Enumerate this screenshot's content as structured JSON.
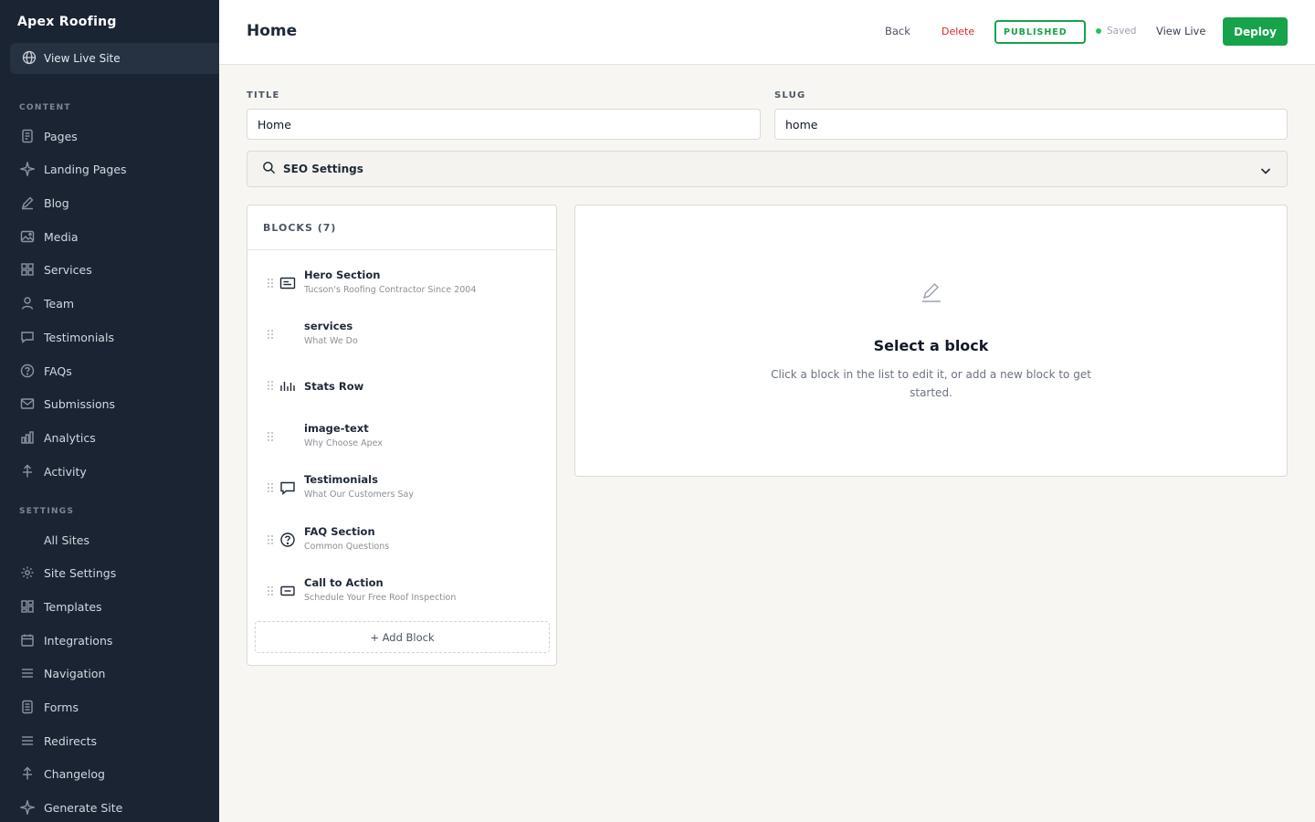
{
  "sidebar": {
    "brand": "Apex Roofing",
    "view_live_site": "View Live Site",
    "content_label": "CONTENT",
    "settings_label": "SETTINGS",
    "content_items": [
      {
        "label": "Pages",
        "icon": "page-icon"
      },
      {
        "label": "Landing Pages",
        "icon": "sparkle-icon"
      },
      {
        "label": "Blog",
        "icon": "pen-icon"
      },
      {
        "label": "Media",
        "icon": "image-icon"
      },
      {
        "label": "Services",
        "icon": "grid-icon"
      },
      {
        "label": "Team",
        "icon": "user-icon"
      },
      {
        "label": "Testimonials",
        "icon": "chat-icon"
      },
      {
        "label": "FAQs",
        "icon": "question-icon"
      },
      {
        "label": "Submissions",
        "icon": "mail-icon"
      },
      {
        "label": "Analytics",
        "icon": "bar-chart-icon"
      },
      {
        "label": "Activity",
        "icon": "activity-icon"
      }
    ],
    "settings_items": [
      {
        "label": "All Sites",
        "icon": ""
      },
      {
        "label": "Site Settings",
        "icon": "gear-icon"
      },
      {
        "label": "Templates",
        "icon": "template-icon"
      },
      {
        "label": "Integrations",
        "icon": "calendar-icon"
      },
      {
        "label": "Navigation",
        "icon": "menu-icon"
      },
      {
        "label": "Forms",
        "icon": "form-icon"
      },
      {
        "label": "Redirects",
        "icon": "redirect-icon"
      },
      {
        "label": "Changelog",
        "icon": "changelog-icon"
      },
      {
        "label": "Generate Site",
        "icon": "sparkle-icon"
      }
    ]
  },
  "header": {
    "title": "Home",
    "back": "Back",
    "delete": "Delete",
    "status": "PUBLISHED",
    "saved": "Saved",
    "view_live": "View Live",
    "deploy": "Deploy"
  },
  "form": {
    "title_label": "TITLE",
    "title_value": "Home",
    "slug_label": "SLUG",
    "slug_value": "home",
    "seo_label": "SEO Settings"
  },
  "blocks": {
    "heading": "BLOCKS (7)",
    "items": [
      {
        "name": "Hero Section",
        "subtitle": "Tucson's Roofing Contractor Since 2004",
        "icon": "hero-icon"
      },
      {
        "name": "services",
        "subtitle": "What We Do",
        "icon": ""
      },
      {
        "name": "Stats Row",
        "subtitle": "",
        "icon": "stats-icon"
      },
      {
        "name": "image-text",
        "subtitle": "Why Choose Apex",
        "icon": ""
      },
      {
        "name": "Testimonials",
        "subtitle": "What Our Customers Say",
        "icon": "chat-icon"
      },
      {
        "name": "FAQ Section",
        "subtitle": "Common Questions",
        "icon": "question-icon"
      },
      {
        "name": "Call to Action",
        "subtitle": "Schedule Your Free Roof Inspection",
        "icon": "cta-icon"
      }
    ],
    "add_label": "+ Add Block"
  },
  "editor": {
    "empty_title": "Select a block",
    "empty_desc": "Click a block in the list to edit it, or add a new block to get started."
  },
  "colors": {
    "sidebar_bg": "#1b2433",
    "accent_green": "#16a34a",
    "delete_red": "#dc2626",
    "page_bg": "#f7f6f2"
  }
}
